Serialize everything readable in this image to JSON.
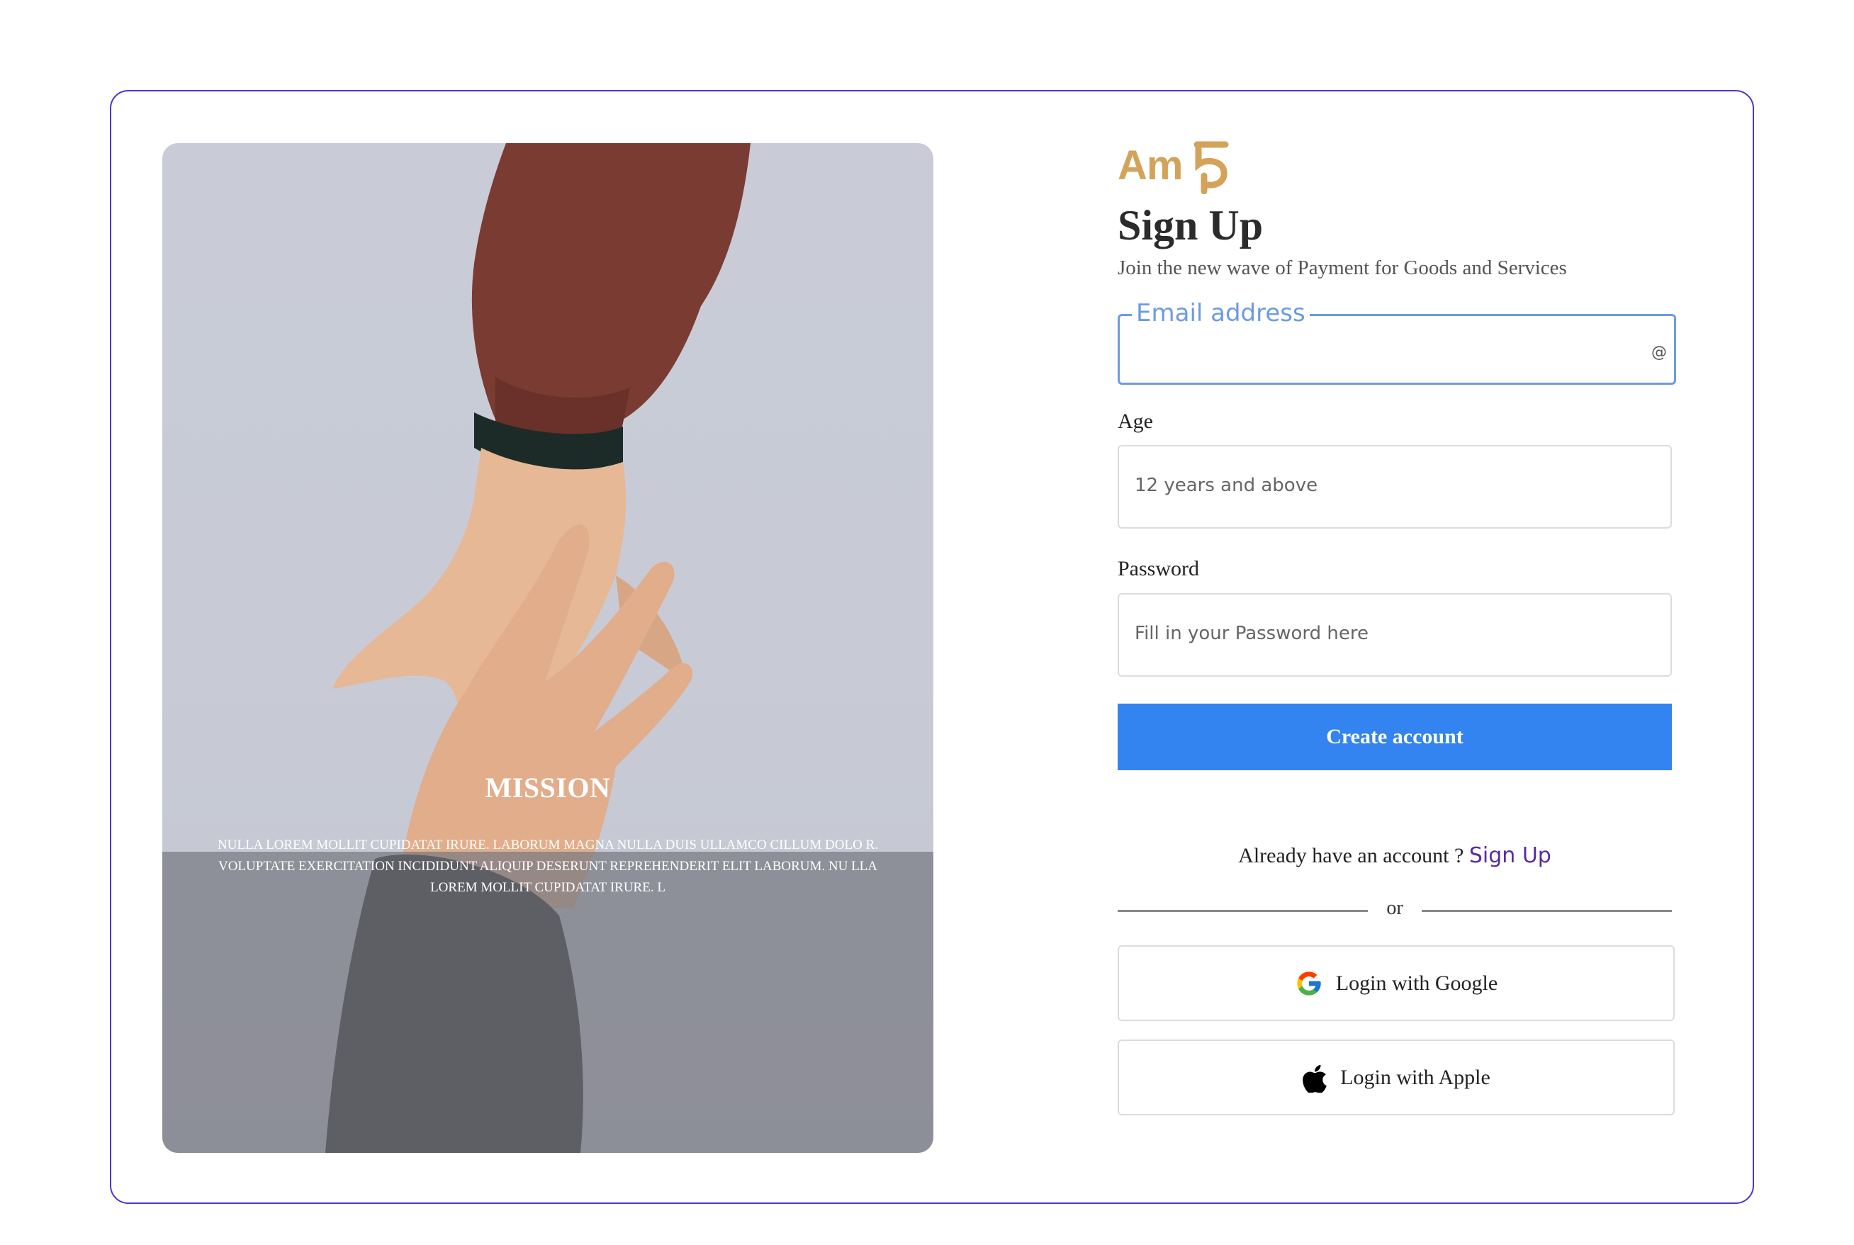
{
  "brand": {
    "logo_text": "Am",
    "logo_mark": "5",
    "logo_color": "#d4a35a"
  },
  "hero": {
    "title": "MISSION",
    "text": "Nulla Lorem mollit cupidatat irure. Laborum magna nulla duis ullamco cillum dolo r. Voluptate exercitation incididunt aliquip deserunt reprehenderit elit laborum. Nu lla Lorem mollit cupidatat irure. L"
  },
  "form": {
    "title": "Sign Up",
    "subtitle": "Join the new wave of Payment for Goods and Services",
    "email": {
      "label": "Email address",
      "icon": "@"
    },
    "age": {
      "label": "Age",
      "placeholder": "12 years and above"
    },
    "password": {
      "label": "Password",
      "placeholder": "Fill in your Password here"
    },
    "submit_label": "Create account",
    "already_text": "Already have an account ?",
    "already_link": "Sign Up",
    "or_text": "or",
    "google_label": "Login with Google",
    "apple_label": "Login with Apple"
  },
  "colors": {
    "frame_border": "#4a35d6",
    "primary_button": "#3383f1",
    "focus_border": "#6c9be3",
    "link": "#5a2ca0"
  }
}
